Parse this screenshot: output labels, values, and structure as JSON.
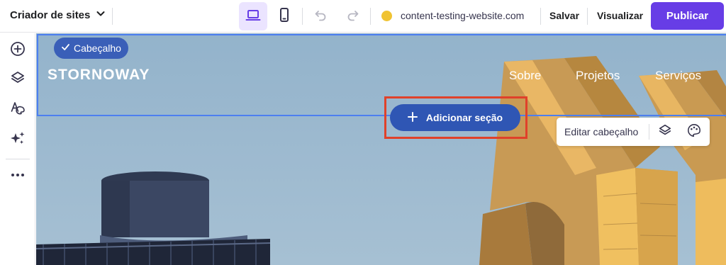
{
  "topbar": {
    "brand_label": "Criador de sites",
    "domain": "content-testing-website.com",
    "save_label": "Salvar",
    "preview_label": "Visualizar",
    "publish_label": "Publicar",
    "active_device": "desktop",
    "status_color": "#f0c332",
    "accent_color": "#673de6"
  },
  "sidebar": {
    "items": [
      {
        "icon": "plus-circle-icon"
      },
      {
        "icon": "layers-icon"
      },
      {
        "icon": "typography-palette-icon"
      },
      {
        "icon": "ai-sparkles-icon"
      },
      {
        "icon": "more-icon"
      }
    ]
  },
  "canvas": {
    "header_chip_label": "Cabeçalho",
    "site_logo": "STORNOWAY",
    "nav_items": [
      "Sobre",
      "Projetos",
      "Serviços"
    ],
    "add_section_label": "Adicionar seção",
    "edit_header_label": "Editar cabeçalho"
  }
}
